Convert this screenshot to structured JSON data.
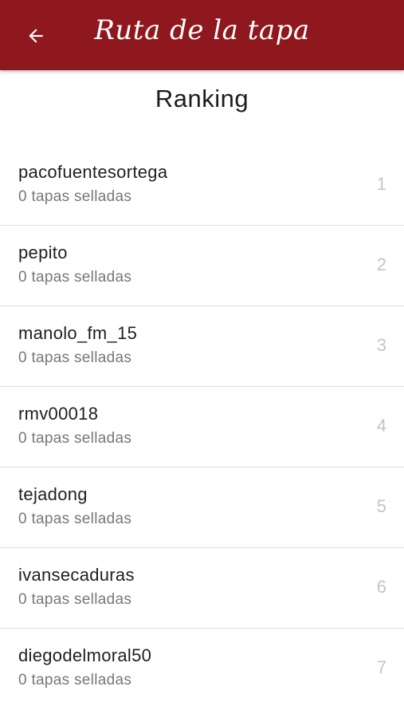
{
  "header": {
    "title": "Ruta de la tapa",
    "back_icon": "arrow-left-icon",
    "bg_color": "#8e181d"
  },
  "page": {
    "title": "Ranking"
  },
  "ranking": [
    {
      "name": "pacofuentesortega",
      "stamps": "0 tapas selladas",
      "position": "1"
    },
    {
      "name": "pepito",
      "stamps": "0 tapas selladas",
      "position": "2"
    },
    {
      "name": "manolo_fm_15",
      "stamps": "0 tapas selladas",
      "position": "3"
    },
    {
      "name": "rmv00018",
      "stamps": "0 tapas selladas",
      "position": "4"
    },
    {
      "name": "tejadong",
      "stamps": "0 tapas selladas",
      "position": "5"
    },
    {
      "name": "ivansecaduras",
      "stamps": "0 tapas selladas",
      "position": "6"
    },
    {
      "name": "diegodelmoral50",
      "stamps": "0 tapas selladas",
      "position": "7"
    }
  ]
}
